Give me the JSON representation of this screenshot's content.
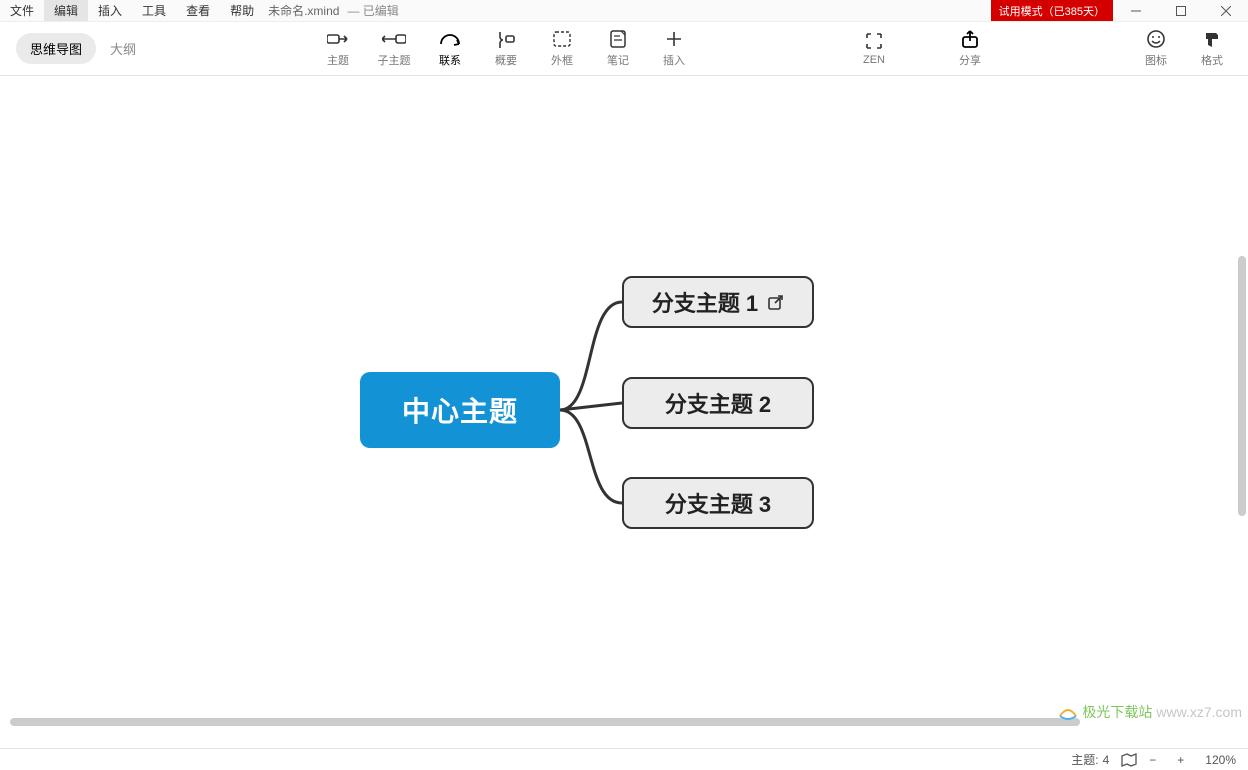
{
  "menu": {
    "items": [
      "文件",
      "编辑",
      "插入",
      "工具",
      "查看",
      "帮助"
    ],
    "activeIndex": 1
  },
  "document": {
    "name": "未命名.xmind",
    "status": "— 已编辑"
  },
  "trial": "试用模式（已385天）",
  "viewSwitch": {
    "mindmap": "思维导图",
    "outline": "大纲"
  },
  "toolbar": [
    {
      "id": "topic",
      "label": "主题",
      "icon": "topic"
    },
    {
      "id": "subtopic",
      "label": "子主题",
      "icon": "subtopic"
    },
    {
      "id": "relation",
      "label": "联系",
      "icon": "relation",
      "emph": true
    },
    {
      "id": "summary",
      "label": "概要",
      "icon": "summary"
    },
    {
      "id": "boundary",
      "label": "外框",
      "icon": "boundary"
    },
    {
      "id": "note",
      "label": "笔记",
      "icon": "note"
    },
    {
      "id": "insert",
      "label": "插入",
      "icon": "plus"
    }
  ],
  "toolbarRight": [
    {
      "id": "zen",
      "label": "ZEN",
      "icon": "zen"
    },
    {
      "id": "share",
      "label": "分享",
      "icon": "share"
    }
  ],
  "toolbarEnd": [
    {
      "id": "icons",
      "label": "图标",
      "icon": "smiley"
    },
    {
      "id": "format",
      "label": "格式",
      "icon": "format"
    }
  ],
  "mindmap": {
    "central": "中心主题",
    "branches": [
      {
        "text": "分支主题 1",
        "hasLink": true
      },
      {
        "text": "分支主题 2",
        "hasLink": false
      },
      {
        "text": "分支主题 3",
        "hasLink": false
      }
    ]
  },
  "statusbar": {
    "topicLabel": "主题:",
    "topicCount": "4",
    "zoom": "120%"
  },
  "watermark": {
    "text": "极光下载站",
    "url": "www.xz7.com"
  }
}
